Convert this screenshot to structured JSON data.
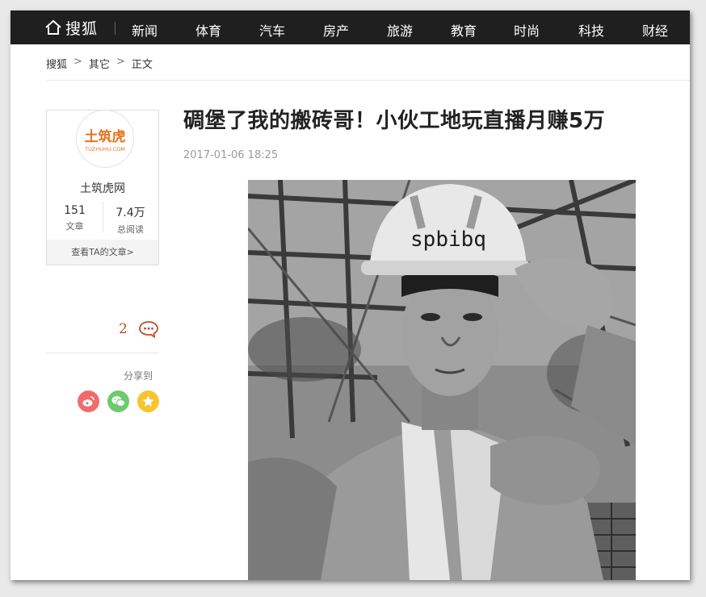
{
  "nav": {
    "logo": "搜狐",
    "items": [
      "新闻",
      "体育",
      "汽车",
      "房产",
      "旅游",
      "教育",
      "时尚",
      "科技",
      "财经"
    ]
  },
  "breadcrumb": {
    "home": "搜狐",
    "category": "其它",
    "current": "正文",
    "separator": ">"
  },
  "author": {
    "logo_text": "土筑虎",
    "logo_sub": "TUZHUHU.COM",
    "name": "土筑虎网",
    "articles_count": "151",
    "articles_label": "文章",
    "reads_count": "7.4万",
    "reads_label": "总阅读",
    "view_articles_link": "查看TA的文章>"
  },
  "comments": {
    "count": "2"
  },
  "share": {
    "label": "分享到",
    "icons": [
      "weibo-icon",
      "wechat-icon",
      "favorite-icon"
    ]
  },
  "article": {
    "title": "碉堡了我的搬砖哥！小伙工地玩直播月赚5万",
    "time": "2017-01-06 18:25",
    "helmet_text": "spbibq"
  },
  "colors": {
    "nav_bg": "#1f1f1f",
    "accent_orange": "#e8731f",
    "comment_red": "#c44b2a",
    "weibo": "#f06c6c",
    "wechat": "#6ccb6c",
    "favorite": "#f5c531"
  }
}
